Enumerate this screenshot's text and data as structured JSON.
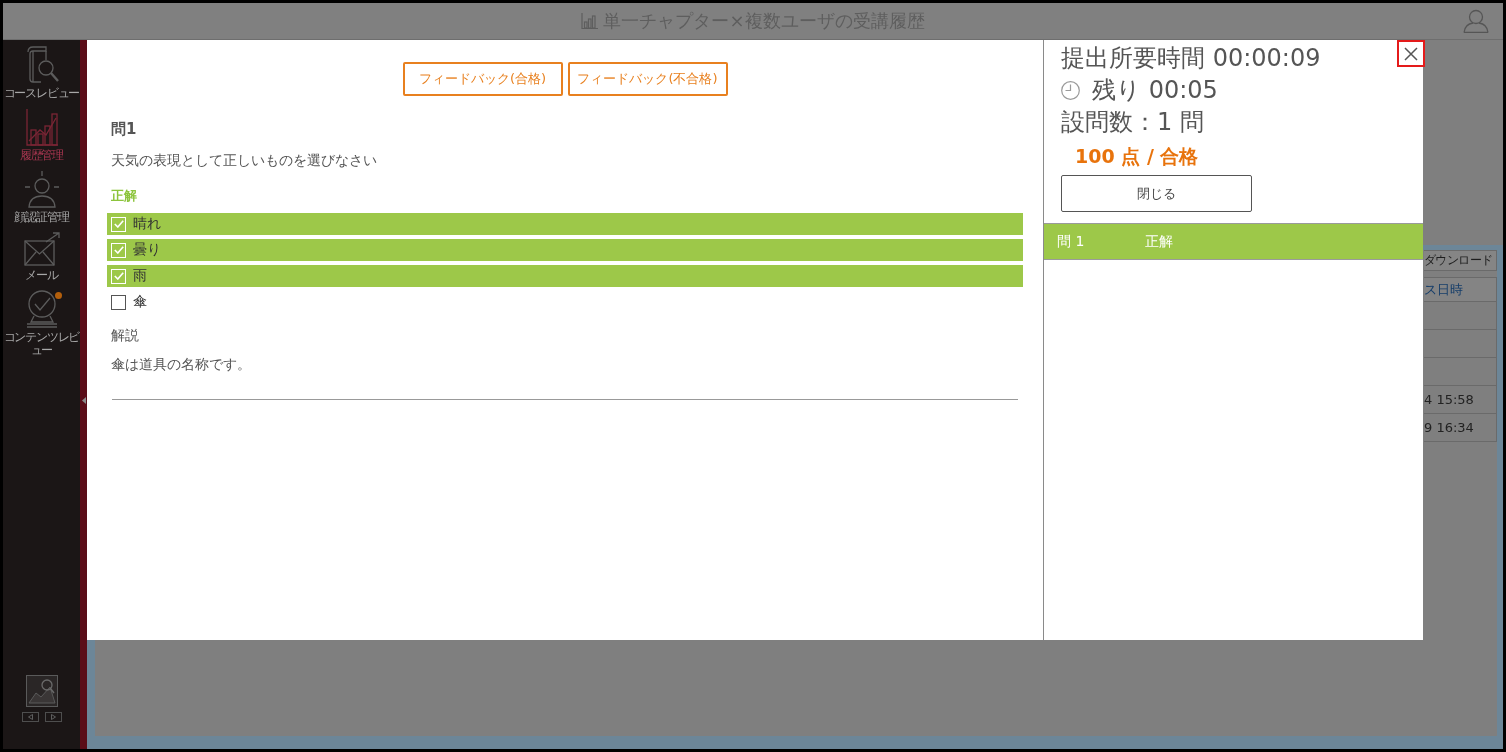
{
  "header": {
    "title": "単一チャプター×複数ユーザの受講履歴"
  },
  "sidebar": {
    "items": [
      {
        "kind": "book",
        "label": "コースレビュー",
        "selected": false,
        "notice": false
      },
      {
        "kind": "chart",
        "label": "履歴管理",
        "selected": true,
        "notice": false
      },
      {
        "kind": "person",
        "label": "顔認証管理",
        "selected": false,
        "notice": false
      },
      {
        "kind": "mail",
        "label": "メール",
        "selected": false,
        "notice": false
      },
      {
        "kind": "badge",
        "label": "コンテンツレビュー",
        "selected": false,
        "notice": true
      }
    ]
  },
  "background_table": {
    "download_button": "ダウンロード",
    "column_header": "ス日時",
    "rows": [
      "4 15:58",
      "9 16:34"
    ]
  },
  "modal": {
    "close_button": {
      "highlighted": true
    },
    "feedback_buttons": [
      {
        "label": "フィードバック(合格)"
      },
      {
        "label": "フィードバック(不合格)"
      }
    ],
    "question": {
      "number": "問1",
      "text": "天気の表現として正しいものを選びなさい",
      "answer_heading": "正解",
      "options": [
        {
          "label": "晴れ",
          "checked": true,
          "correct": true
        },
        {
          "label": "曇り",
          "checked": true,
          "correct": true
        },
        {
          "label": "雨",
          "checked": true,
          "correct": true
        },
        {
          "label": "傘",
          "checked": false,
          "correct": false
        }
      ],
      "explanation_heading": "解説",
      "explanation": "傘は道具の名称です。"
    },
    "summary": {
      "elapsed": "提出所要時間 00:00:09",
      "remaining": "残り 00:05",
      "question_count": "設問数：1 問",
      "score": "100 点 / 合格",
      "close_label": "閉じる"
    },
    "results": [
      {
        "question": "問 1",
        "result": "正解",
        "correct": true
      }
    ]
  }
}
